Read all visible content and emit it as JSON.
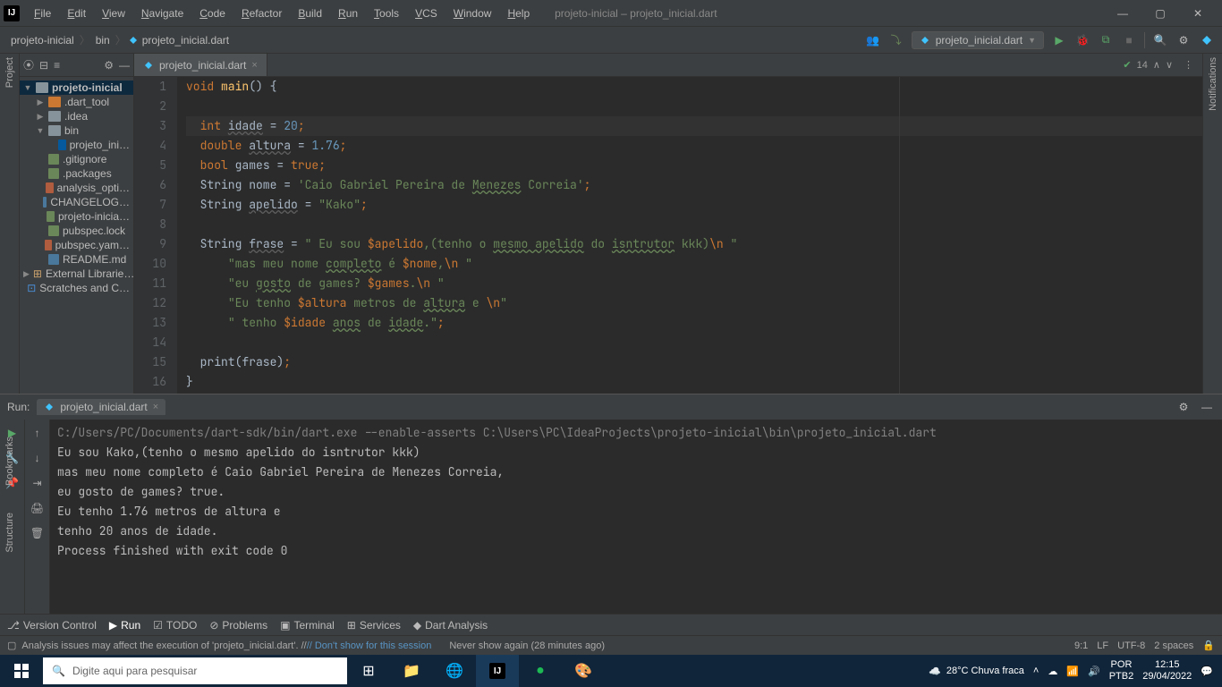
{
  "window": {
    "title": "projeto-inicial – projeto_inicial.dart",
    "menus": [
      "File",
      "Edit",
      "View",
      "Navigate",
      "Code",
      "Refactor",
      "Build",
      "Run",
      "Tools",
      "VCS",
      "Window",
      "Help"
    ]
  },
  "breadcrumbs": [
    "projeto-inicial",
    "bin",
    "projeto_inicial.dart"
  ],
  "run_config": "projeto_inicial.dart",
  "indicators": {
    "checks": "14"
  },
  "project_tree": {
    "root": "projeto-inicial",
    "items": [
      {
        "name": ".dart_tool",
        "kind": "folder-orange",
        "depth": 1,
        "arrow": "▶"
      },
      {
        "name": ".idea",
        "kind": "folder",
        "depth": 1,
        "arrow": "▶"
      },
      {
        "name": "bin",
        "kind": "folder",
        "depth": 1,
        "arrow": "▼"
      },
      {
        "name": "projeto_ini…",
        "kind": "dart",
        "depth": 2,
        "arrow": ""
      },
      {
        "name": ".gitignore",
        "kind": "file",
        "depth": 1,
        "arrow": ""
      },
      {
        "name": ".packages",
        "kind": "file",
        "depth": 1,
        "arrow": ""
      },
      {
        "name": "analysis_opti…",
        "kind": "yml",
        "depth": 1,
        "arrow": ""
      },
      {
        "name": "CHANGELOG…",
        "kind": "md",
        "depth": 1,
        "arrow": ""
      },
      {
        "name": "projeto-inicia…",
        "kind": "file",
        "depth": 1,
        "arrow": ""
      },
      {
        "name": "pubspec.lock",
        "kind": "file",
        "depth": 1,
        "arrow": ""
      },
      {
        "name": "pubspec.yam…",
        "kind": "yml",
        "depth": 1,
        "arrow": ""
      },
      {
        "name": "README.md",
        "kind": "md",
        "depth": 1,
        "arrow": ""
      }
    ],
    "ext_libs": "External Librarie…",
    "scratches": "Scratches and C…"
  },
  "editor_tab": "projeto_inicial.dart",
  "code_lines": [
    {
      "n": 1,
      "seg": [
        [
          "kw",
          "void"
        ],
        [
          "",
          ""
        ],
        [
          "fn",
          " main"
        ],
        [
          "",
          "() "
        ],
        [
          "",
          "{"
        ]
      ]
    },
    {
      "n": 2,
      "seg": [
        [
          "",
          ""
        ]
      ]
    },
    {
      "n": 3,
      "hl": true,
      "seg": [
        [
          "",
          "  "
        ],
        [
          "kw",
          "int"
        ],
        [
          "",
          " "
        ],
        [
          "ident-u",
          "idade"
        ],
        [
          "",
          " = "
        ],
        [
          "num",
          "20"
        ],
        [
          "punct",
          ";"
        ]
      ]
    },
    {
      "n": 4,
      "seg": [
        [
          "",
          "  "
        ],
        [
          "kw",
          "double"
        ],
        [
          "",
          " "
        ],
        [
          "ident-u",
          "altura"
        ],
        [
          "",
          " = "
        ],
        [
          "num",
          "1.76"
        ],
        [
          "punct",
          ";"
        ]
      ]
    },
    {
      "n": 5,
      "seg": [
        [
          "",
          "  "
        ],
        [
          "kw",
          "bool"
        ],
        [
          "",
          " games = "
        ],
        [
          "kw",
          "true"
        ],
        [
          "punct",
          ";"
        ]
      ]
    },
    {
      "n": 6,
      "seg": [
        [
          "",
          "  "
        ],
        [
          "",
          "String nome = "
        ],
        [
          "str",
          "'Caio Gabriel Pereira de "
        ],
        [
          "str typo",
          "Menezes"
        ],
        [
          "str",
          " Correia'"
        ],
        [
          "punct",
          ";"
        ]
      ]
    },
    {
      "n": 7,
      "seg": [
        [
          "",
          "  "
        ],
        [
          "",
          "String "
        ],
        [
          "ident-u",
          "apelido"
        ],
        [
          "",
          " = "
        ],
        [
          "str",
          "\"Kako\""
        ],
        [
          "punct",
          ";"
        ]
      ]
    },
    {
      "n": 8,
      "seg": [
        [
          "",
          ""
        ]
      ]
    },
    {
      "n": 9,
      "seg": [
        [
          "",
          "  "
        ],
        [
          "",
          "String "
        ],
        [
          "ident-u",
          "frase"
        ],
        [
          "",
          " = "
        ],
        [
          "str",
          "\" Eu sou "
        ],
        [
          "str-int",
          "$apelido"
        ],
        [
          "str",
          ",(tenho o "
        ],
        [
          "str typo",
          "mesmo apelido"
        ],
        [
          "str",
          " do "
        ],
        [
          "str typo",
          "isntrutor"
        ],
        [
          "str",
          " kkk)"
        ],
        [
          "str-esc",
          "\\n"
        ],
        [
          "str",
          " \""
        ]
      ]
    },
    {
      "n": 10,
      "seg": [
        [
          "",
          "      "
        ],
        [
          "str",
          "\"mas meu nome "
        ],
        [
          "str typo",
          "completo"
        ],
        [
          "str",
          " é "
        ],
        [
          "str-int",
          "$nome"
        ],
        [
          "str",
          ","
        ],
        [
          "str-esc",
          "\\n"
        ],
        [
          "str",
          " \""
        ]
      ]
    },
    {
      "n": 11,
      "seg": [
        [
          "",
          "      "
        ],
        [
          "str",
          "\"eu "
        ],
        [
          "str typo",
          "gosto"
        ],
        [
          "str",
          " de games? "
        ],
        [
          "str-int",
          "$games"
        ],
        [
          "str",
          "."
        ],
        [
          "str-esc",
          "\\n"
        ],
        [
          "str",
          " \""
        ]
      ]
    },
    {
      "n": 12,
      "seg": [
        [
          "",
          "      "
        ],
        [
          "str",
          "\"Eu tenho "
        ],
        [
          "str-int",
          "$altura"
        ],
        [
          "str",
          " metros de "
        ],
        [
          "str typo",
          "altura"
        ],
        [
          "str",
          " e "
        ],
        [
          "str-esc",
          "\\n"
        ],
        [
          "str",
          "\""
        ]
      ]
    },
    {
      "n": 13,
      "seg": [
        [
          "",
          "      "
        ],
        [
          "str",
          "\" tenho "
        ],
        [
          "str-int",
          "$idade"
        ],
        [
          "str",
          " "
        ],
        [
          "str typo",
          "anos"
        ],
        [
          "str",
          " de "
        ],
        [
          "str typo",
          "idade"
        ],
        [
          "str",
          ".\""
        ],
        [
          "punct",
          ";"
        ]
      ]
    },
    {
      "n": 14,
      "seg": [
        [
          "",
          ""
        ]
      ]
    },
    {
      "n": 15,
      "seg": [
        [
          "",
          "  print("
        ],
        [
          "",
          "frase"
        ],
        [
          "",
          ")"
        ],
        [
          "punct",
          ";"
        ]
      ]
    },
    {
      "n": 16,
      "seg": [
        [
          "",
          "}"
        ]
      ]
    }
  ],
  "console": {
    "cmd": "C:/Users/PC/Documents/dart-sdk/bin/dart.exe --enable-asserts C:\\Users\\PC\\IdeaProjects\\projeto-inicial\\bin\\projeto_inicial.dart",
    "out": [
      " Eu sou Kako,(tenho o mesmo apelido do isntrutor kkk)",
      " mas meu nome completo é Caio Gabriel Pereira de Menezes Correia,",
      " eu gosto de games? true.",
      " Eu tenho 1.76 metros de altura e",
      " tenho 20 anos de idade.",
      "",
      "Process finished with exit code 0"
    ]
  },
  "bottom_tools": [
    "Version Control",
    "Run",
    "TODO",
    "Problems",
    "Terminal",
    "Services",
    "Dart Analysis"
  ],
  "status": {
    "msg": "Analysis issues may affect the execution of 'projeto_inicial.dart'. // ",
    "link1": "// Don't show for this session",
    "link2": "Never show again (28 minutes ago)",
    "pos": "9:1",
    "le": "LF",
    "enc": "UTF-8",
    "indent": "2 spaces"
  },
  "taskbar": {
    "search_ph": "Digite aqui para pesquisar",
    "weather": "28°C  Chuva fraca",
    "lang1": "POR",
    "lang2": "PTB2",
    "time": "12:15",
    "date": "29/04/2022"
  },
  "run_label": "Run:"
}
